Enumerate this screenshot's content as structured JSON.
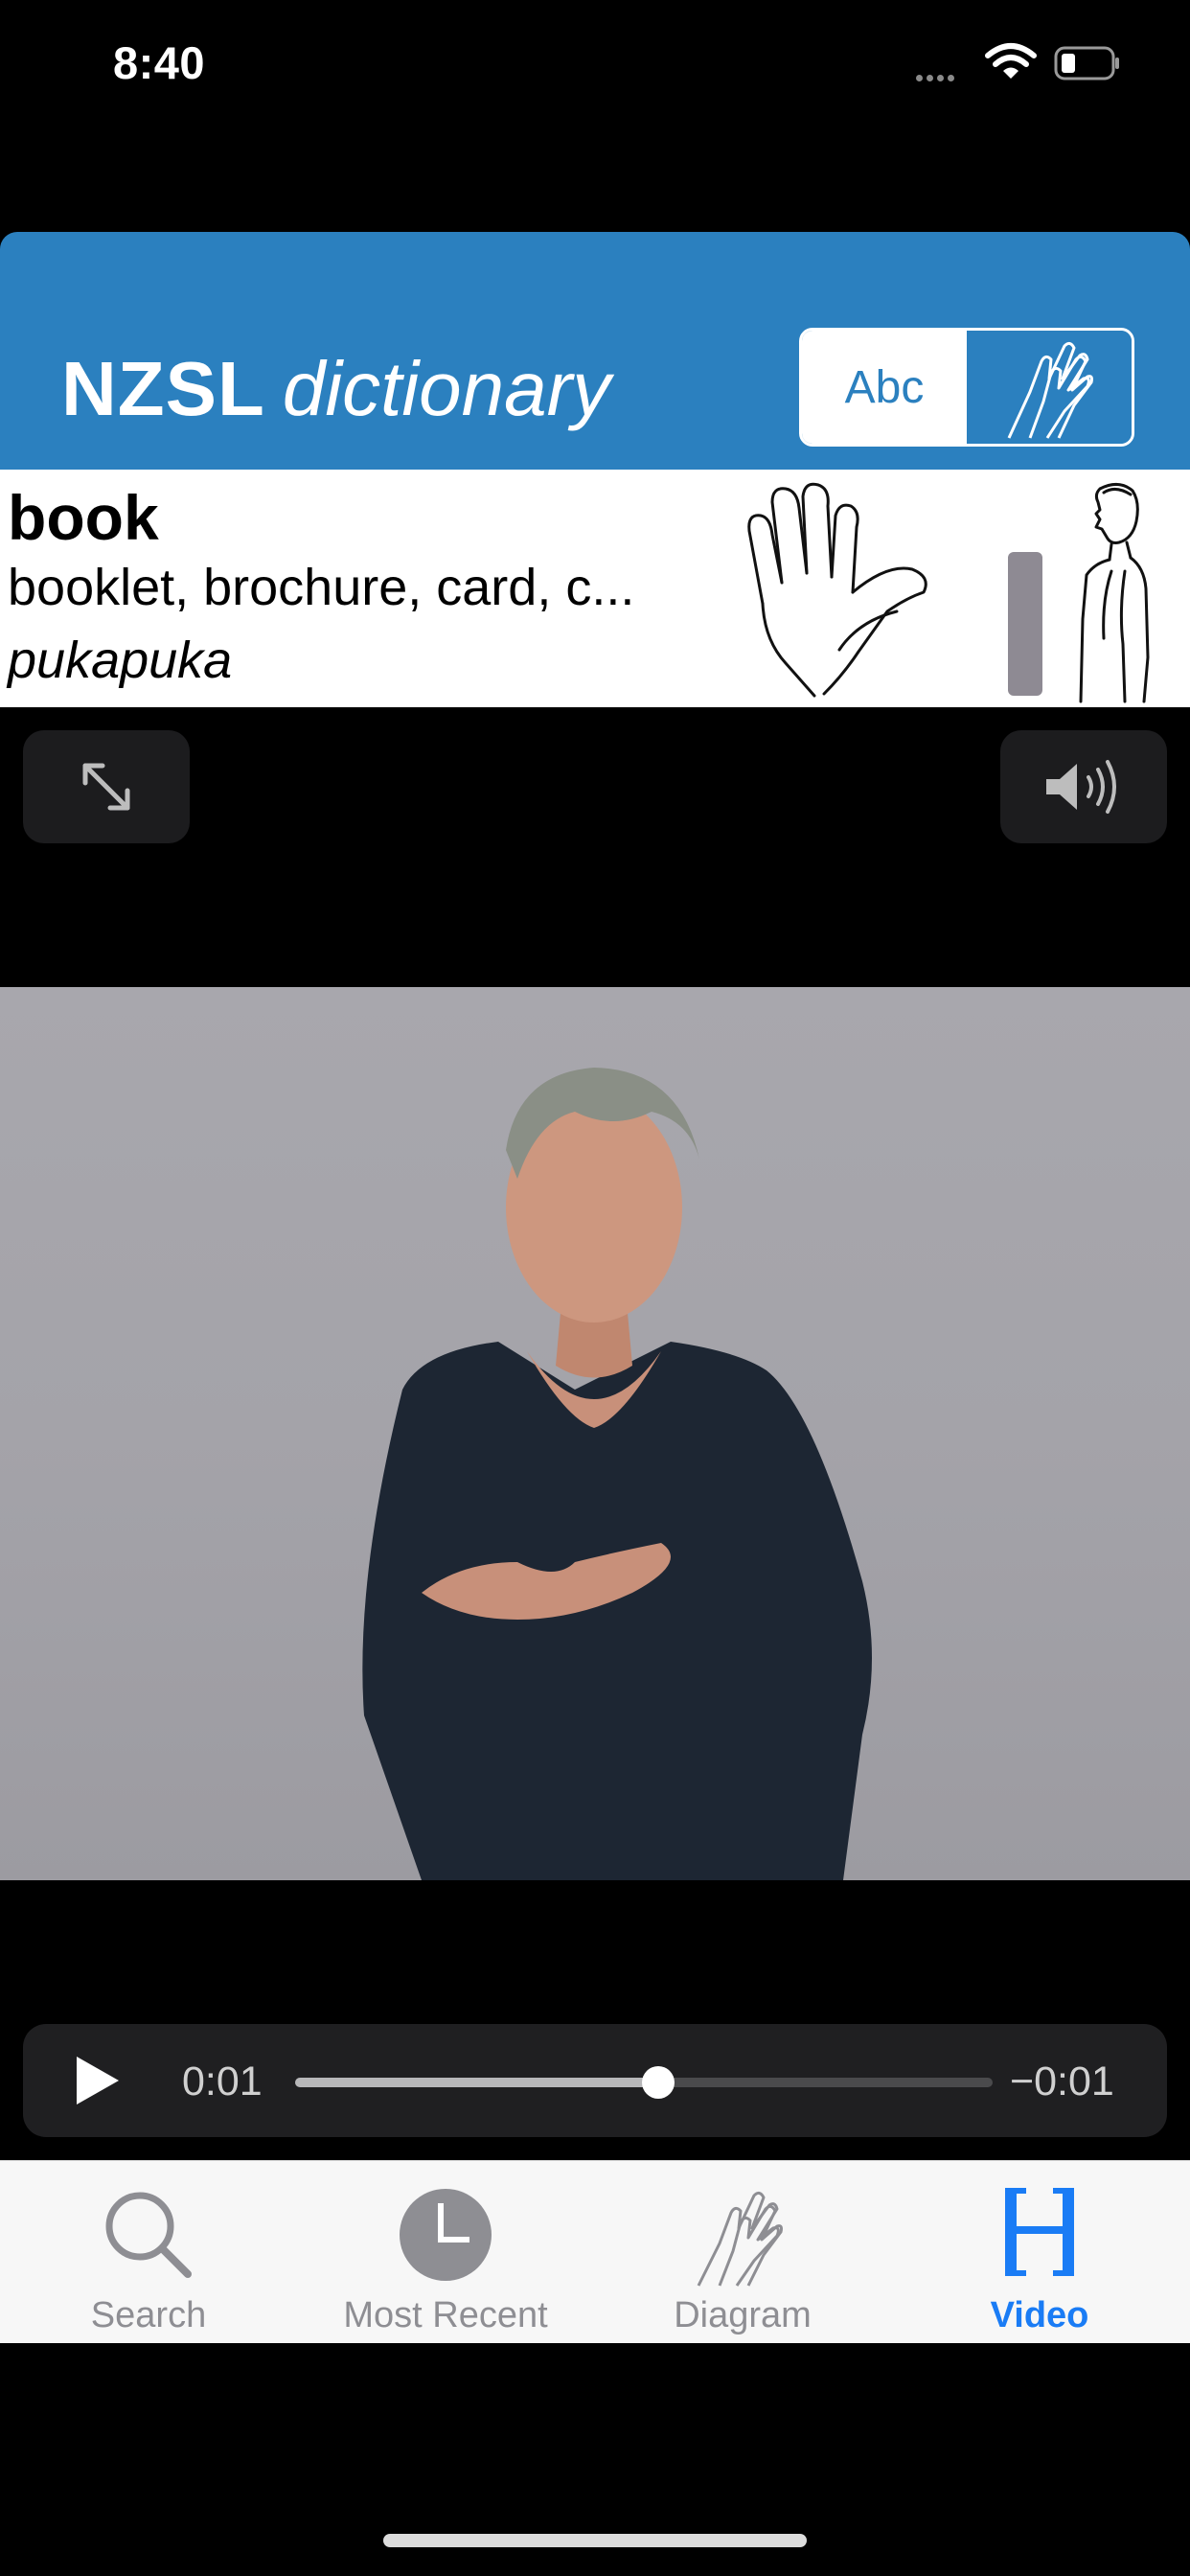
{
  "status": {
    "time": "8:40",
    "icons": [
      "signal-dots-icon",
      "wifi-icon",
      "battery-low-icon"
    ]
  },
  "header": {
    "brand_bold": "NZSL",
    "brand_italic": "dictionary",
    "toggle": {
      "text_label": "Abc",
      "sign_icon": "two-hands-sign-icon",
      "selected": "Abc"
    },
    "color": "#2b80bf"
  },
  "entry": {
    "word": "book",
    "glosses": "booklet, brochure, card, c...",
    "maori": "pukapuka",
    "diagram_icons": [
      "handshape-diagram",
      "location-diagram"
    ]
  },
  "controls": {
    "expand_icon": "expand-arrows-icon",
    "sound_icon": "speaker-icon"
  },
  "video": {
    "description": "sign language video frame"
  },
  "player": {
    "elapsed": "0:01",
    "remaining": "−0:01",
    "progress": 0.52,
    "play_icon": "play-icon"
  },
  "tabs": [
    {
      "label": "Search",
      "icon": "search-icon",
      "active": false
    },
    {
      "label": "Most Recent",
      "icon": "clock-icon",
      "active": false
    },
    {
      "label": "Diagram",
      "icon": "hands-diagram-icon",
      "active": false
    },
    {
      "label": "Video",
      "icon": "film-strip-icon",
      "active": true
    }
  ],
  "colors": {
    "accent": "#1a7cf5",
    "inactive": "#8e8e93"
  }
}
